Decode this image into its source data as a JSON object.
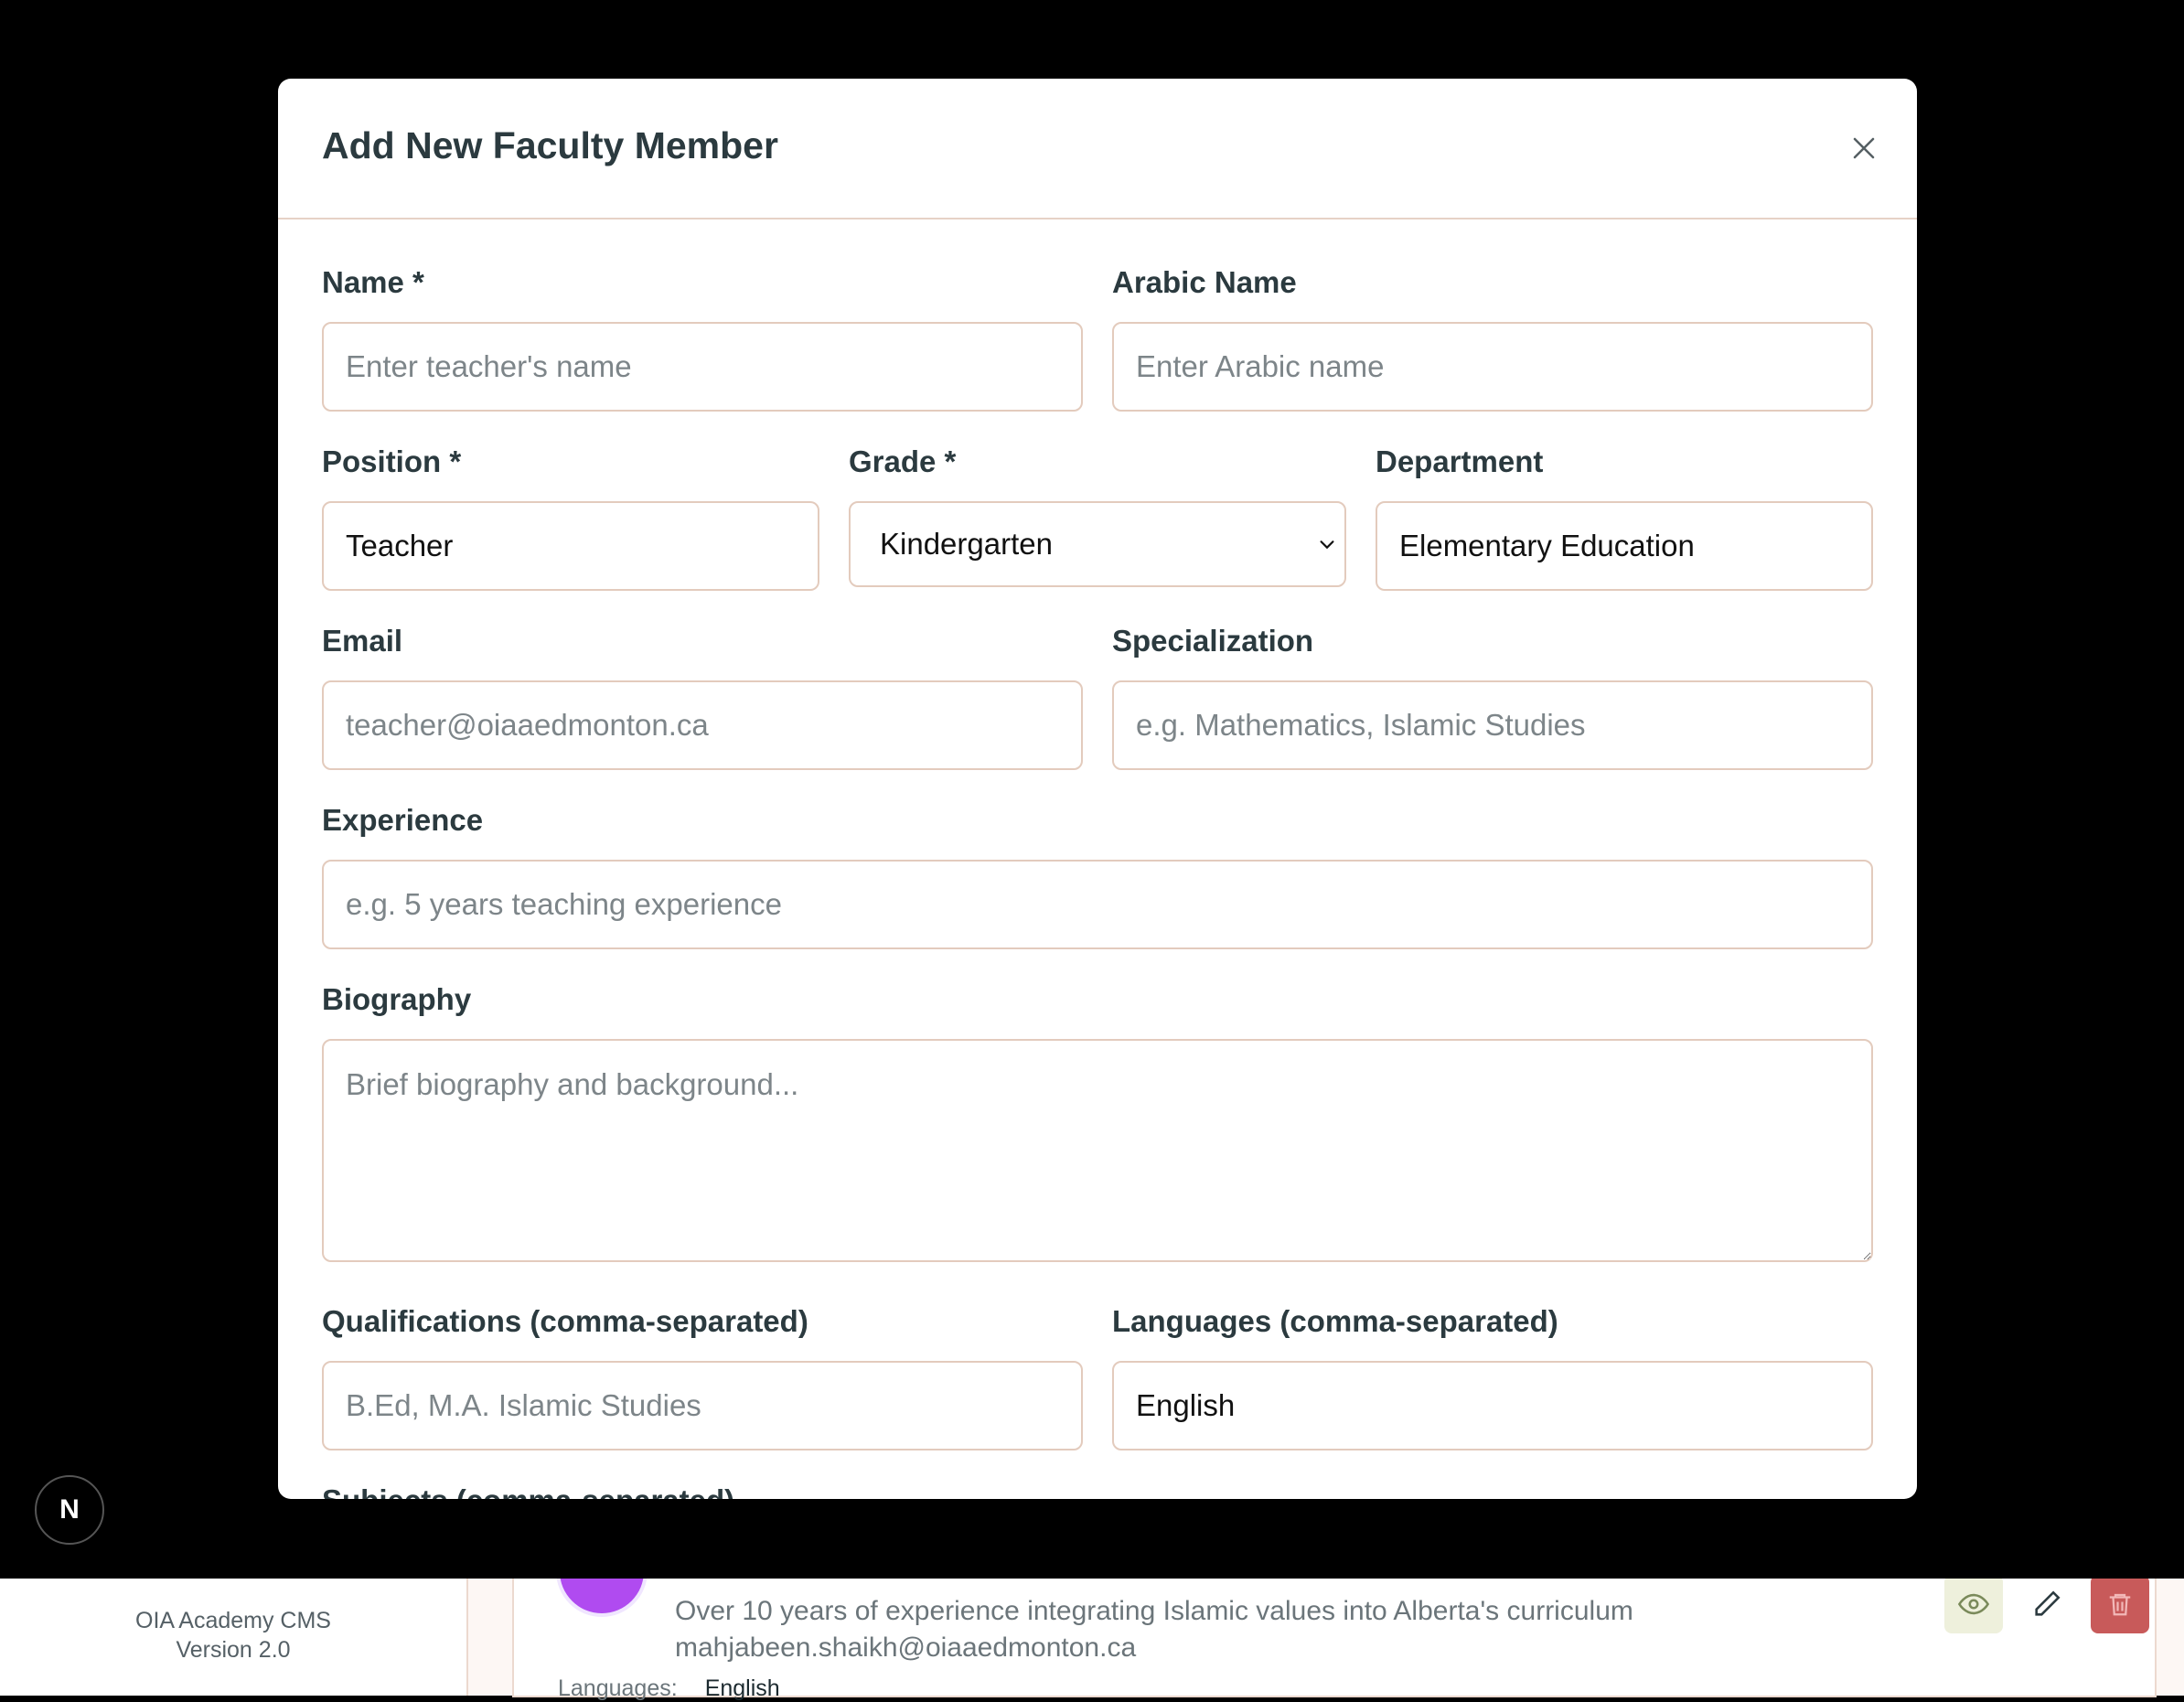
{
  "modal": {
    "title": "Add New Faculty Member",
    "close_icon": "close-icon"
  },
  "form": {
    "name": {
      "label": "Name *",
      "placeholder": "Enter teacher's name",
      "value": ""
    },
    "arabic_name": {
      "label": "Arabic Name",
      "placeholder": "Enter Arabic name",
      "value": ""
    },
    "position": {
      "label": "Position *",
      "value": "Teacher"
    },
    "grade": {
      "label": "Grade *",
      "selected": "Kindergarten"
    },
    "department": {
      "label": "Department",
      "value": "Elementary Education"
    },
    "email": {
      "label": "Email",
      "placeholder": "teacher@oiaaedmonton.ca",
      "value": ""
    },
    "specialization": {
      "label": "Specialization",
      "placeholder": "e.g. Mathematics, Islamic Studies",
      "value": ""
    },
    "experience": {
      "label": "Experience",
      "placeholder": "e.g. 5 years teaching experience",
      "value": ""
    },
    "biography": {
      "label": "Biography",
      "placeholder": "Brief biography and background...",
      "value": ""
    },
    "qualifications": {
      "label": "Qualifications (comma-separated)",
      "placeholder": "B.Ed, M.A. Islamic Studies",
      "value": ""
    },
    "languages": {
      "label": "Languages (comma-separated)",
      "value": "English"
    },
    "subjects": {
      "label": "Subjects (comma-separated)"
    }
  },
  "background": {
    "sidebar": {
      "app_name": "OIA Academy CMS",
      "version": "Version 2.0"
    },
    "card": {
      "description": "Over 10 years of experience integrating Islamic values into Alberta's curriculum",
      "email": "mahjabeen.shaikh@oiaaedmonton.ca",
      "languages_label": "Languages:",
      "languages_value": "English"
    }
  },
  "next_badge": {
    "letter": "N"
  },
  "colors": {
    "accent_border": "#e3cbbd",
    "delete": "#c85a5a",
    "avatar": "#b04bf0"
  }
}
